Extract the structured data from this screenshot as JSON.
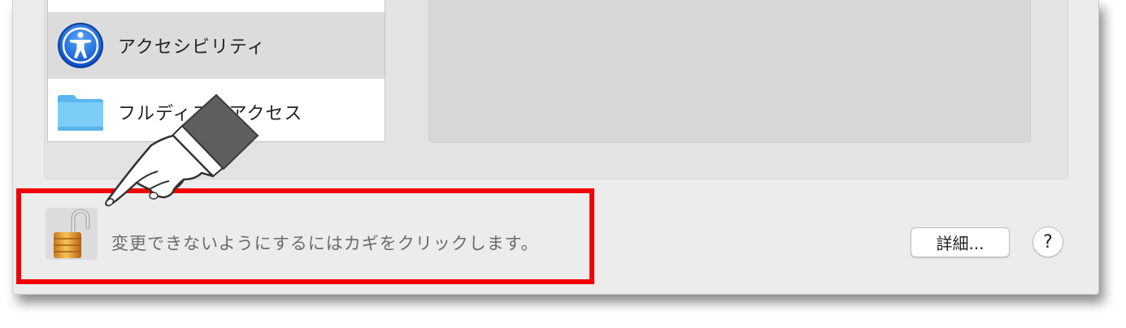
{
  "sidebar": {
    "items": [
      {
        "label": "アクセシビリティ",
        "icon": "accessibility-icon",
        "selected": true
      },
      {
        "label": "フルディスクアクセス",
        "icon": "folder-icon",
        "selected": false
      }
    ]
  },
  "lock": {
    "icon": "unlocked-padlock-icon",
    "message": "変更できないようにするにはカギをクリックします。"
  },
  "buttons": {
    "advanced_label": "詳細...",
    "help_label": "?"
  },
  "annotation": {
    "highlight_color": "#f00000",
    "pointer": "pointing-hand-icon"
  },
  "colors": {
    "window_bg": "#ececec",
    "selected_row": "#dcdcdc",
    "accessibility_blue": "#1f6fe0",
    "folder_blue": "#6fc3f4"
  }
}
